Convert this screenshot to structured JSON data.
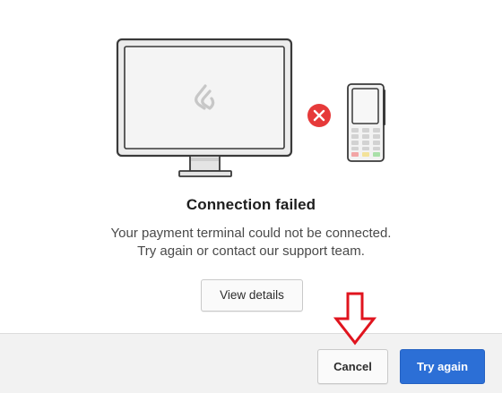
{
  "dialog": {
    "title": "Connection failed",
    "message_line1": "Your payment terminal could not be connected.",
    "message_line2": "Try again or contact our support team.",
    "view_details_label": "View details"
  },
  "footer": {
    "cancel_label": "Cancel",
    "try_again_label": "Try again"
  },
  "colors": {
    "primary": "#2c6fd6",
    "error": "#e63a3a",
    "annotation": "#e0141e"
  },
  "icons": {
    "monitor": "monitor-icon",
    "brand_logo": "flame-logo-icon",
    "error": "error-x-icon",
    "terminal": "payment-terminal-icon",
    "arrow": "down-arrow-annotation"
  }
}
